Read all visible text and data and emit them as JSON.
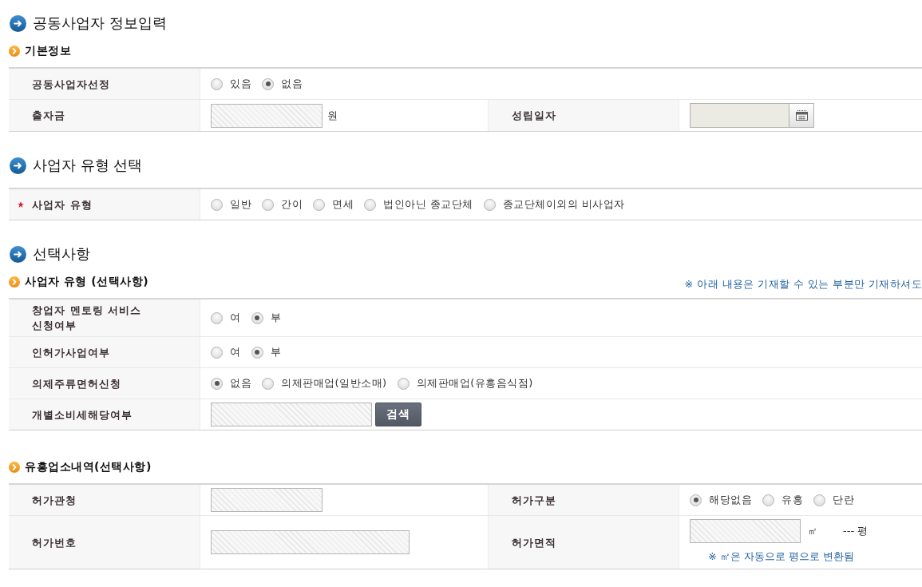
{
  "blocks": [
    {
      "kind": "heading",
      "text": "공동사업자 정보입력"
    },
    {
      "kind": "subheading",
      "text": "기본정보"
    },
    {
      "kind": "table",
      "rows": [
        [
          {
            "label": "공동사업자선정",
            "required": false,
            "control": {
              "kind": "radios",
              "options": [
                {
                  "label": "있음",
                  "selected": false
                },
                {
                  "label": "없음",
                  "selected": true
                }
              ]
            }
          }
        ],
        [
          {
            "label": "출자금",
            "required": false,
            "control": {
              "kind": "input",
              "unit": "원"
            }
          },
          {
            "label": "성립일자",
            "required": false,
            "control": {
              "kind": "date"
            }
          }
        ]
      ]
    },
    {
      "kind": "heading",
      "text": "사업자 유형 선택"
    },
    {
      "kind": "table",
      "rows": [
        [
          {
            "label": "사업자 유형",
            "required": true,
            "control": {
              "kind": "radios",
              "options": [
                {
                  "label": "일반",
                  "selected": false
                },
                {
                  "label": "간이",
                  "selected": false
                },
                {
                  "label": "면세",
                  "selected": false
                },
                {
                  "label": "법인아닌 종교단체",
                  "selected": false
                },
                {
                  "label": "종교단체이외의 비사업자",
                  "selected": false
                }
              ]
            }
          }
        ]
      ]
    },
    {
      "kind": "heading",
      "text": "선택사항"
    },
    {
      "kind": "subheading",
      "text": "사업자 유형 (선택사항)",
      "note": "※ 아래 내용은 기재할 수 있는 부분만 기재하셔도"
    },
    {
      "kind": "table",
      "rows": [
        [
          {
            "label": "창업자 멘토링 서비스 신청여부",
            "required": false,
            "control": {
              "kind": "radios",
              "options": [
                {
                  "label": "여",
                  "selected": false
                },
                {
                  "label": "부",
                  "selected": true
                }
              ]
            }
          }
        ],
        [
          {
            "label": "인허가사업여부",
            "required": false,
            "control": {
              "kind": "radios",
              "options": [
                {
                  "label": "여",
                  "selected": false
                },
                {
                  "label": "부",
                  "selected": true
                }
              ]
            }
          }
        ],
        [
          {
            "label": "의제주류면허신청",
            "required": false,
            "control": {
              "kind": "radios",
              "options": [
                {
                  "label": "없음",
                  "selected": true
                },
                {
                  "label": "의제판매업(일반소매)",
                  "selected": false
                },
                {
                  "label": "의제판매업(유흥음식점)",
                  "selected": false
                }
              ]
            }
          }
        ],
        [
          {
            "label": "개별소비세해당여부",
            "required": false,
            "control": {
              "kind": "search",
              "button": "검색"
            }
          }
        ]
      ]
    },
    {
      "kind": "subheading",
      "text": "유흥업소내역(선택사항)"
    },
    {
      "kind": "table",
      "rows": [
        [
          {
            "label": "허가관청",
            "required": false,
            "control": {
              "kind": "input"
            }
          },
          {
            "label": "허가구분",
            "required": false,
            "control": {
              "kind": "radios",
              "options": [
                {
                  "label": "해당없음",
                  "selected": true
                },
                {
                  "label": "유흥",
                  "selected": false
                },
                {
                  "label": "단란",
                  "selected": false
                }
              ]
            }
          }
        ],
        [
          {
            "label": "허가번호",
            "required": false,
            "control": {
              "kind": "long-input"
            }
          },
          {
            "label": "허가면적",
            "required": false,
            "control": {
              "kind": "area",
              "unit": "㎡",
              "converted": "--- 평",
              "note": "※ ㎡은 자동으로 평으로 변환됨"
            }
          }
        ]
      ]
    }
  ]
}
